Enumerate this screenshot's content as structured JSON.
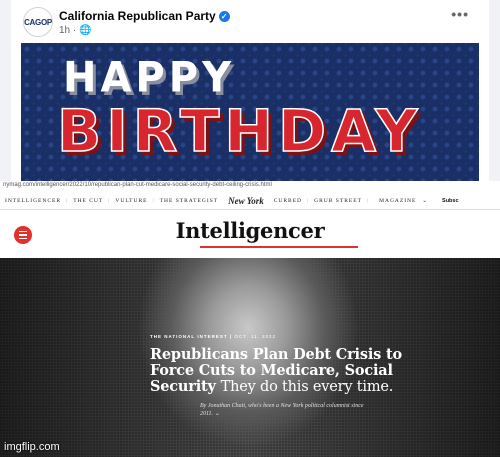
{
  "facebook": {
    "page_name": "California Republican Party",
    "avatar_text": "CAGOP",
    "time": "1h",
    "globe": "🌐",
    "more": "•••",
    "banner_line1": "HAPPY",
    "banner_line2": "BIRTHDAY"
  },
  "url": "nymag.com/intelligencer/2022/10/republican-plan-cut-medicare-social-security-debt-ceiling-crisis.html",
  "nav": {
    "items": [
      "INTELLIGENCER",
      "THE CUT",
      "VULTURE",
      "THE STRATEGIST",
      "CURBED",
      "GRUB STREET",
      "MAGAZINE"
    ],
    "logo": "New York",
    "subscribe": "Subsc"
  },
  "intelligencer": {
    "logo": "Intelligencer"
  },
  "article": {
    "section": "THE NATIONAL INTEREST",
    "date": "OCT. 11, 2022",
    "headline_bold": "Republicans Plan Debt Crisis to Force Cuts to Medicare, Social Security",
    "headline_dek": "They do this every time.",
    "byline": "By Jonathan Chait, who's been a New York political columnist since 2011."
  },
  "watermark": "imgflip.com",
  "colors": {
    "fb_blue": "#1877f2",
    "banner_navy": "#1a2f66",
    "banner_red": "#d8262e",
    "nymag_red": "#e0312b"
  }
}
